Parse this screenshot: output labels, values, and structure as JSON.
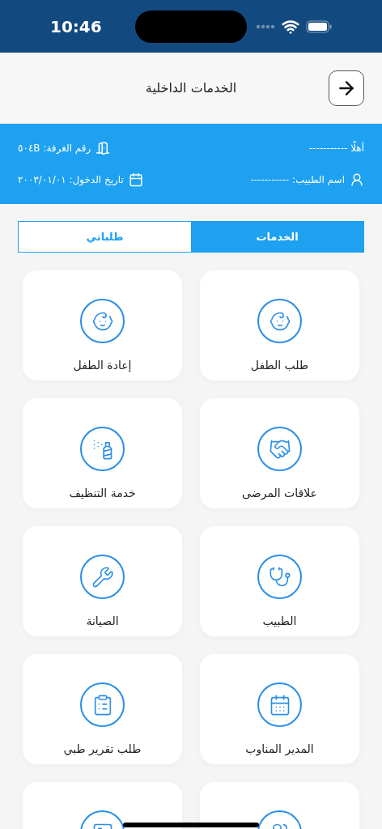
{
  "status_bar": {
    "time": "10:46"
  },
  "header": {
    "title": "الخدمات الداخلية"
  },
  "info": {
    "greeting": "أهلًا -----------",
    "room": "رقم الغرفة: ٥٠٤B",
    "doctor": "اسم الطبيب: -----------",
    "admission": "تاريخ الدخول: ٢٠٠٣/٠١/٠١"
  },
  "tabs": [
    {
      "label": "الخدمات",
      "selected": true
    },
    {
      "label": "طلباتي",
      "selected": false
    }
  ],
  "services": [
    {
      "kind": "service",
      "label": "طلب الطفل"
    },
    {
      "kind": "service",
      "label": "إعادة الطفل"
    },
    {
      "kind": "service",
      "label": "علاقات المرضى"
    },
    {
      "kind": "service",
      "label": "خدمة التنظيف"
    },
    {
      "kind": "service",
      "label": "الطبيب"
    },
    {
      "kind": "service",
      "label": "الصيانة"
    },
    {
      "kind": "service",
      "label": "المدير المناوب"
    },
    {
      "kind": "service",
      "label": "طلب تقرير طبي"
    },
    {
      "kind": "partial"
    },
    {
      "kind": "partial"
    }
  ]
}
